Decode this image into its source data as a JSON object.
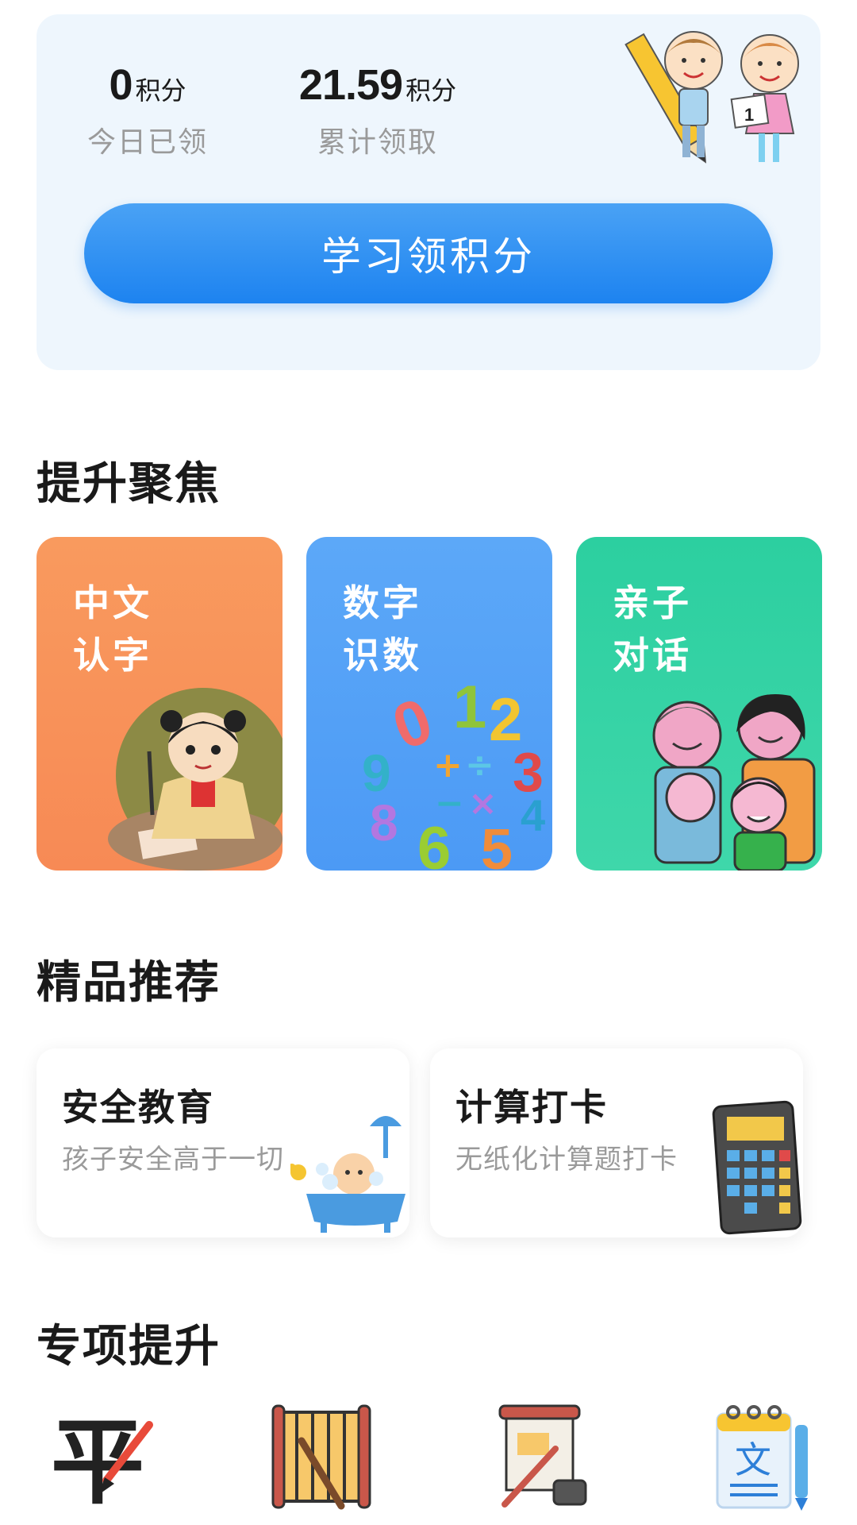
{
  "points": {
    "today_value": "0",
    "today_unit": "积分",
    "today_label": "今日已领",
    "total_value": "21.59",
    "total_unit": "积分",
    "total_label": "累计领取",
    "earn_button": "学习领积分"
  },
  "focus": {
    "title": "提升聚焦",
    "tiles": [
      {
        "line1": "中文",
        "line2": "认字",
        "icon": "chinese-character-child-icon"
      },
      {
        "line1": "数字",
        "line2": "识数",
        "icon": "numbers-icon"
      },
      {
        "line1": "亲子",
        "line2": "对话",
        "icon": "family-icon"
      }
    ]
  },
  "recommend": {
    "title": "精品推荐",
    "cards": [
      {
        "title": "安全教育",
        "subtitle": "孩子安全高于一切",
        "icon": "baby-bath-icon"
      },
      {
        "title": "计算打卡",
        "subtitle": "无纸化计算题打卡",
        "icon": "calculator-icon"
      }
    ]
  },
  "special": {
    "title": "专项提升",
    "icons": [
      "calligraphy-icon",
      "bamboo-scroll-icon",
      "ancient-poem-icon",
      "composition-icon"
    ],
    "icon_glyphs": [
      "平",
      "文"
    ]
  },
  "colors": {
    "accent_blue": "#1d83f0",
    "card_bg": "#eef6fd",
    "tile_orange": "#f78a55",
    "tile_blue": "#4c9af5",
    "tile_green": "#2ccfa0"
  }
}
